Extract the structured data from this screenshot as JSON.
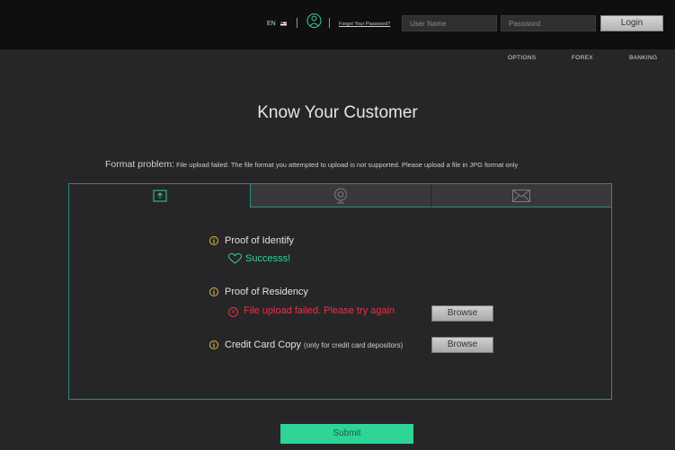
{
  "header": {
    "language": "EN",
    "forgot_password": "Forgot Your Password?",
    "username_placeholder": "User Name",
    "password_placeholder": "Password",
    "login_label": "Login"
  },
  "nav": {
    "options": "OPTIONS",
    "forex": "FOREX",
    "banking": "BANKING"
  },
  "page": {
    "title": "Know Your Customer",
    "format_label": "Format problem:",
    "format_detail": " File upload failed. The file format you attempted to upload is not supported. Please upload a file in JPG format only"
  },
  "tabs": [
    {
      "icon": "upload-icon",
      "active": true
    },
    {
      "icon": "webcam-icon",
      "active": false
    },
    {
      "icon": "mail-icon",
      "active": false
    }
  ],
  "documents": {
    "identity": {
      "label": "Proof of Identify",
      "status": "Successs!"
    },
    "residency": {
      "label": "Proof of Residency",
      "error": "File upload failed. Please try again",
      "browse": "Browse"
    },
    "credit_card": {
      "label": "Credit Card Copy",
      "note": "(only for credit card depositors)",
      "browse": "Browse"
    }
  },
  "submit_label": "Submit",
  "colors": {
    "accent": "#2fd497",
    "error": "#e5334a",
    "info": "#d9b84a",
    "border": "#2e8d74"
  }
}
